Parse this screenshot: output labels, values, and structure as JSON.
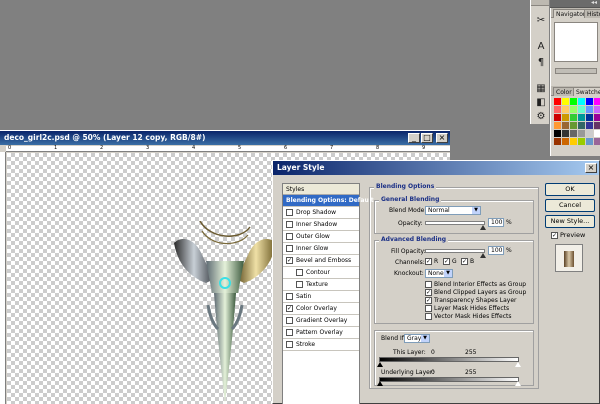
{
  "document": {
    "title": "deco_girl2c.psd @ 50% (Layer 12 copy, RGB/8#)",
    "ruler_numbers": [
      "0",
      "1",
      "2",
      "3",
      "4",
      "5",
      "6",
      "7",
      "8",
      "9"
    ]
  },
  "panels": {
    "navigator_tab": "Navigator",
    "histogram_tab": "Histo",
    "color_tab": "Color",
    "swatches_tab": "Swatche",
    "swatch_colors": [
      "#ff0000",
      "#ffff00",
      "#00ff00",
      "#00ffff",
      "#0000ff",
      "#ff00ff",
      "#ff6666",
      "#ffcc66",
      "#99ff66",
      "#66ffcc",
      "#6699ff",
      "#cc66ff",
      "#cc0000",
      "#cc9900",
      "#33cc33",
      "#009999",
      "#003399",
      "#990099",
      "#ff9933",
      "#996633",
      "#669933",
      "#336666",
      "#333399",
      "#663366",
      "#000000",
      "#333333",
      "#666666",
      "#999999",
      "#cccccc",
      "#ffffff",
      "#993300",
      "#cc6600",
      "#ffcc00",
      "#99cc00",
      "#6699cc",
      "#996699"
    ]
  },
  "dialog": {
    "title": "Layer Style",
    "styles_header": "Styles",
    "styles": [
      {
        "label": "Blending Options: Default",
        "selected": true,
        "checkbox": false,
        "checked": false,
        "indent": false
      },
      {
        "label": "Drop Shadow",
        "selected": false,
        "checkbox": true,
        "checked": false,
        "indent": false
      },
      {
        "label": "Inner Shadow",
        "selected": false,
        "checkbox": true,
        "checked": false,
        "indent": false
      },
      {
        "label": "Outer Glow",
        "selected": false,
        "checkbox": true,
        "checked": false,
        "indent": false
      },
      {
        "label": "Inner Glow",
        "selected": false,
        "checkbox": true,
        "checked": false,
        "indent": false
      },
      {
        "label": "Bevel and Emboss",
        "selected": false,
        "checkbox": true,
        "checked": true,
        "indent": false
      },
      {
        "label": "Contour",
        "selected": false,
        "checkbox": true,
        "checked": false,
        "indent": true
      },
      {
        "label": "Texture",
        "selected": false,
        "checkbox": true,
        "checked": false,
        "indent": true
      },
      {
        "label": "Satin",
        "selected": false,
        "checkbox": true,
        "checked": false,
        "indent": false
      },
      {
        "label": "Color Overlay",
        "selected": false,
        "checkbox": true,
        "checked": true,
        "indent": false
      },
      {
        "label": "Gradient Overlay",
        "selected": false,
        "checkbox": true,
        "checked": false,
        "indent": false
      },
      {
        "label": "Pattern Overlay",
        "selected": false,
        "checkbox": true,
        "checked": false,
        "indent": false
      },
      {
        "label": "Stroke",
        "selected": false,
        "checkbox": true,
        "checked": false,
        "indent": false
      }
    ],
    "blending_options_label": "Blending Options",
    "general_blending_label": "General Blending",
    "blend_mode_label": "Blend Mode:",
    "blend_mode_value": "Normal",
    "opacity_label": "Opacity:",
    "opacity_value": "100",
    "percent": "%",
    "advanced_blending_label": "Advanced Blending",
    "fill_opacity_label": "Fill Opacity:",
    "fill_opacity_value": "100",
    "channels_label": "Channels:",
    "channel_r": "R",
    "channel_g": "G",
    "channel_b": "B",
    "knockout_label": "Knockout:",
    "knockout_value": "None",
    "adv_options": [
      {
        "label": "Blend Interior Effects as Group",
        "checked": false
      },
      {
        "label": "Blend Clipped Layers as Group",
        "checked": true
      },
      {
        "label": "Transparency Shapes Layer",
        "checked": true
      },
      {
        "label": "Layer Mask Hides Effects",
        "checked": false
      },
      {
        "label": "Vector Mask Hides Effects",
        "checked": false
      }
    ],
    "blend_if_label": "Blend If:",
    "blend_if_value": "Gray",
    "this_layer_label": "This Layer:",
    "this_layer_low": "0",
    "this_layer_high": "255",
    "underlying_layer_label": "Underlying Layer:",
    "underlying_low": "0",
    "underlying_high": "255",
    "ok_label": "OK",
    "cancel_label": "Cancel",
    "new_style_label": "New Style...",
    "preview_label": "Preview",
    "preview_checked": true
  }
}
